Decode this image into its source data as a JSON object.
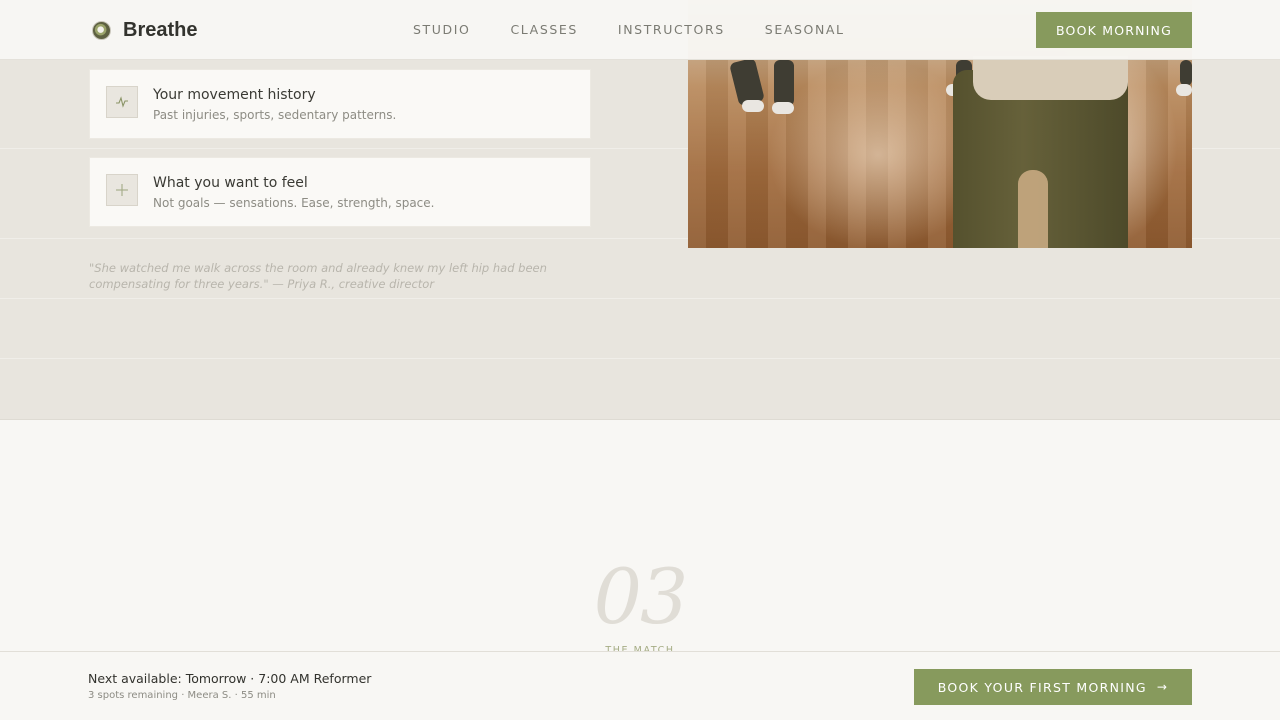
{
  "brand": {
    "name": "Breathe"
  },
  "nav": {
    "items": [
      "STUDIO",
      "CLASSES",
      "INSTRUCTORS",
      "SEASONAL"
    ]
  },
  "header": {
    "cta_label": "BOOK MORNING"
  },
  "cards": [
    {
      "icon": "pulse-icon",
      "title": "Your movement history",
      "subtitle": "Past injuries, sports, sedentary patterns."
    },
    {
      "icon": "plus-icon",
      "title": "What you want to feel",
      "subtitle": "Not goals — sensations. Ease, strength, space."
    }
  ],
  "testimonial": {
    "text": "\"She watched me walk across the room and already knew my left hip had been compensating for three years.\" — Priya R., creative director"
  },
  "section": {
    "number": "03",
    "label": "THE MATCH"
  },
  "sticky": {
    "next_available": "Next available: Tomorrow · 7:00 AM Reformer",
    "meta": "3 spots remaining · Meera S. · 55 min",
    "cta_label": "BOOK YOUR FIRST MORNING",
    "cta_arrow": "→"
  },
  "colors": {
    "accent": "#879a5d",
    "beige": "#e8e5de",
    "background": "#f8f7f4"
  }
}
